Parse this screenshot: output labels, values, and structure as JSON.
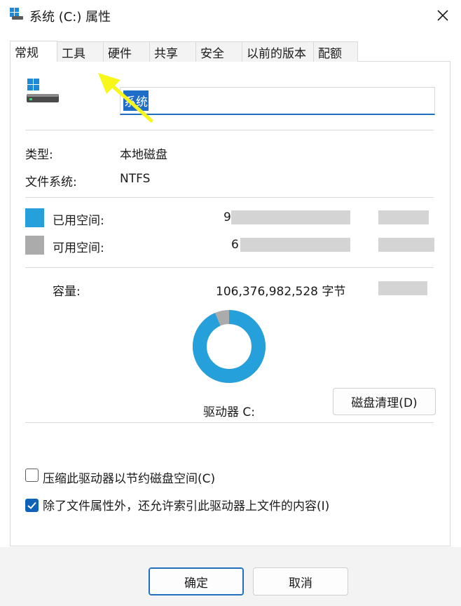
{
  "window": {
    "title": "系统 (C:) 属性",
    "close_icon": "close-icon"
  },
  "tabs": [
    {
      "label": "常规",
      "active": true
    },
    {
      "label": "工具",
      "active": false
    },
    {
      "label": "硬件",
      "active": false
    },
    {
      "label": "共享",
      "active": false
    },
    {
      "label": "安全",
      "active": false
    },
    {
      "label": "以前的版本",
      "active": false
    },
    {
      "label": "配额",
      "active": false
    }
  ],
  "general": {
    "drive_name": "系统",
    "type_label": "类型:",
    "type_value": "本地磁盘",
    "fs_label": "文件系统:",
    "fs_value": "NTFS",
    "used_label": "已用空间:",
    "used_value_visible": "9",
    "free_label": "可用空间:",
    "free_value_visible": "6",
    "capacity_label": "容量:",
    "capacity_value": "106,376,982,528 字节",
    "drive_label": "驱动器 C:",
    "cleanup_button": "磁盘清理(D)",
    "compress_checkbox": {
      "label": "压缩此驱动器以节约磁盘空间(C)",
      "checked": false
    },
    "index_checkbox": {
      "label": "除了文件属性外，还允许索引此驱动器上文件的内容(I)",
      "checked": true
    }
  },
  "usage": {
    "used_fraction": 0.935,
    "used_color": "#26a0da",
    "free_color": "#ababab"
  },
  "footer": {
    "ok_button": "确定",
    "cancel_button": "取消"
  }
}
